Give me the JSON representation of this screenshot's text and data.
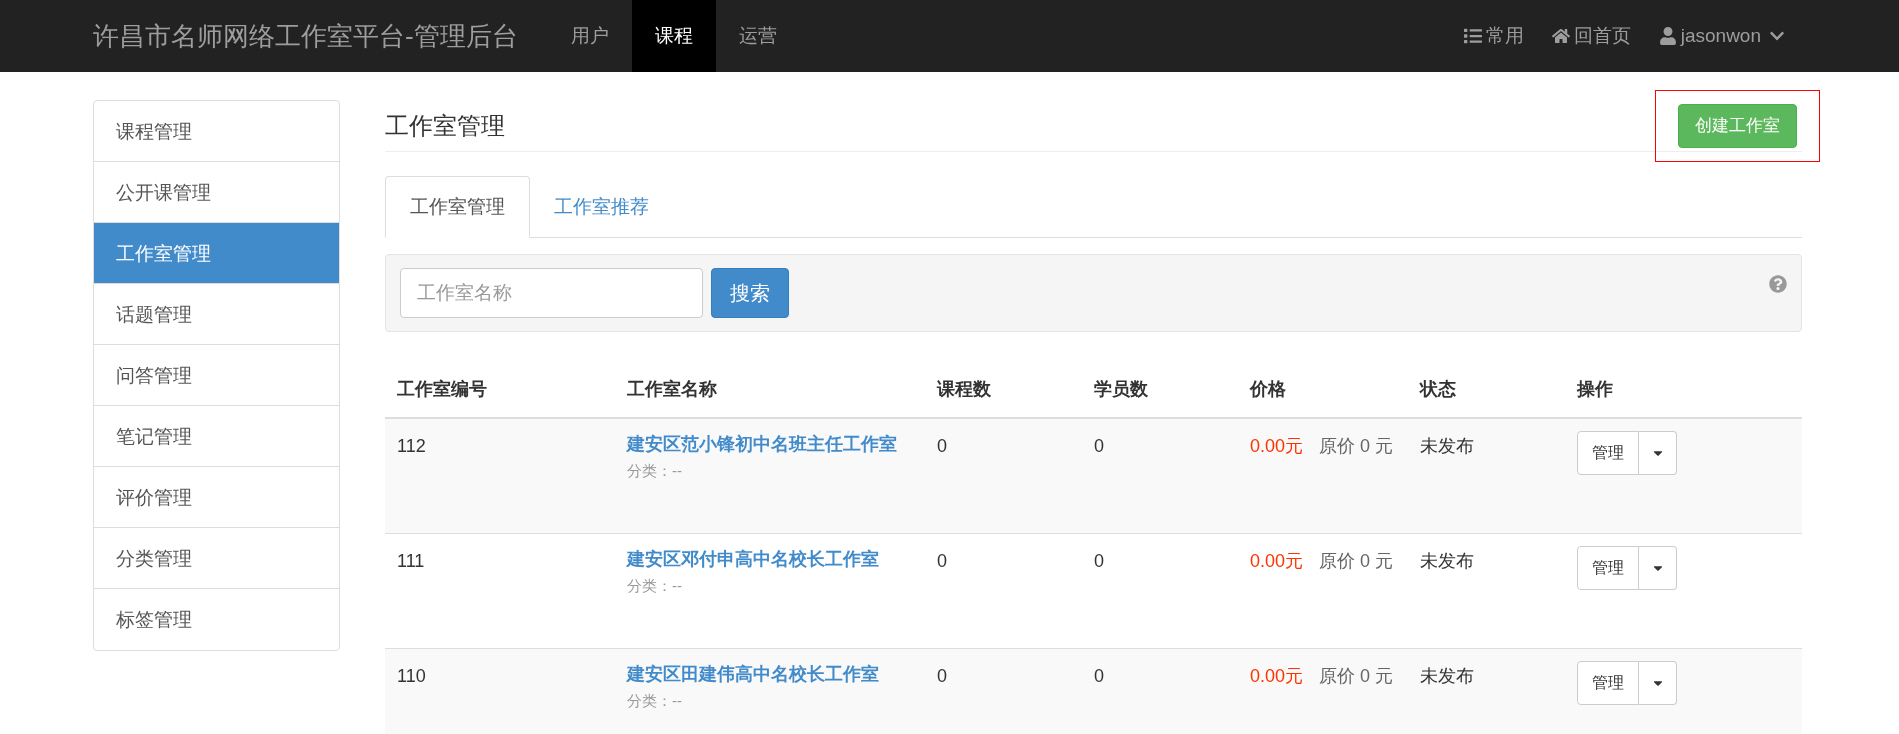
{
  "navbar": {
    "brand": "许昌市名师网络工作室平台-管理后台",
    "items": [
      {
        "label": "用户",
        "selected": false
      },
      {
        "label": "课程",
        "selected": true
      },
      {
        "label": "运营",
        "selected": false
      }
    ],
    "right": [
      {
        "kind": "list",
        "label": "常用"
      },
      {
        "kind": "home",
        "label": "回首页"
      },
      {
        "kind": "user",
        "label": "jasonwon"
      }
    ]
  },
  "sidebar": {
    "items": [
      {
        "label": "课程管理",
        "selected": false
      },
      {
        "label": "公开课管理",
        "selected": false
      },
      {
        "label": "工作室管理",
        "selected": true
      },
      {
        "label": "话题管理",
        "selected": false
      },
      {
        "label": "问答管理",
        "selected": false
      },
      {
        "label": "笔记管理",
        "selected": false
      },
      {
        "label": "评价管理",
        "selected": false
      },
      {
        "label": "分类管理",
        "selected": false
      },
      {
        "label": "标签管理",
        "selected": false
      }
    ]
  },
  "page": {
    "title": "工作室管理",
    "create_button": "创建工作室"
  },
  "tabs": [
    {
      "label": "工作室管理",
      "selected": true
    },
    {
      "label": "工作室推荐",
      "selected": false
    }
  ],
  "search": {
    "placeholder": "工作室名称",
    "button": "搜索"
  },
  "table": {
    "columns": [
      "工作室编号",
      "工作室名称",
      "课程数",
      "学员数",
      "价格",
      "状态",
      "操作"
    ],
    "rows": [
      {
        "id": "112",
        "name": "建安区范小锋初中名班主任工作室",
        "category": "分类：--",
        "courses": "0",
        "students": "0",
        "price": "0.00元",
        "original_price": "原价 0 元",
        "status": "未发布",
        "action": "管理"
      },
      {
        "id": "111",
        "name": "建安区邓付申高中名校长工作室",
        "category": "分类：--",
        "courses": "0",
        "students": "0",
        "price": "0.00元",
        "original_price": "原价 0 元",
        "status": "未发布",
        "action": "管理"
      },
      {
        "id": "110",
        "name": "建安区田建伟高中名校长工作室",
        "category": "分类：--",
        "courses": "0",
        "students": "0",
        "price": "0.00元",
        "original_price": "原价 0 元",
        "status": "未发布",
        "action": "管理"
      }
    ]
  }
}
